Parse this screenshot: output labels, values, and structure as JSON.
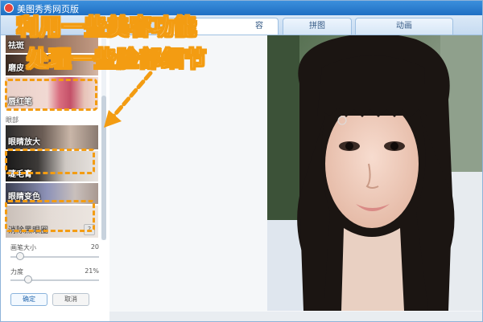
{
  "window": {
    "title": "美图秀秀网页版"
  },
  "tabs": [
    {
      "label": "容",
      "active": true
    },
    {
      "label": "拼图",
      "active": false
    },
    {
      "label": "动画",
      "active": false
    }
  ],
  "tools": {
    "partial_top": "祛斑",
    "mopi": "磨皮",
    "lipstick": "唇红笔",
    "section_eye": "眼部",
    "enlarge_eye": "眼睛放大",
    "mascara": "睫毛膏",
    "eye_color": "眼睛变色",
    "dark_circle": "消除黑眼圈",
    "help": "?"
  },
  "sliders": {
    "brush_size": {
      "label": "画笔大小",
      "value_text": "20",
      "level": 0.1
    },
    "strength": {
      "label": "力度",
      "value_text": "21%",
      "level": 0.21
    }
  },
  "buttons": {
    "ok": "确定",
    "cancel": "取消"
  },
  "annotation": {
    "line1": "利用一些美容功能",
    "line2": "处理一些脸部细节"
  },
  "colors": {
    "accent": "#f39c12",
    "titlebar": "#1f6fc3"
  }
}
